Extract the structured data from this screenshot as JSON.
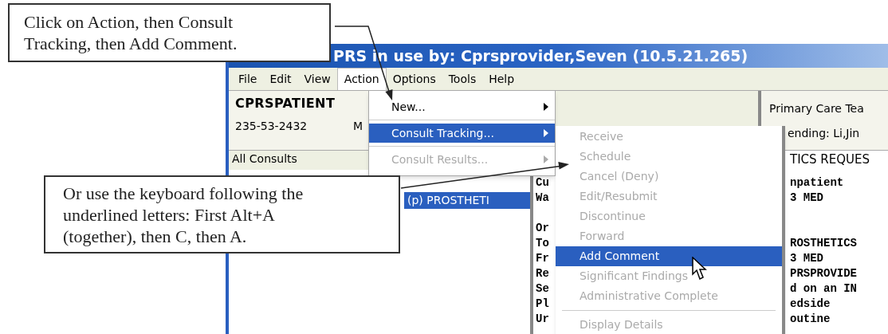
{
  "callouts": [
    {
      "text": "Click on Action, then Consult Tracking, then Add Comment."
    },
    {
      "text": "Or use the keyboard following the underlined letters: First Alt+A (together), then C, then A."
    }
  ],
  "window": {
    "title": "PRS in use by: Cprsprovider,Seven  (10.5.21.265)"
  },
  "menubar": [
    {
      "label": "File",
      "selected": false
    },
    {
      "label": "Edit",
      "selected": false
    },
    {
      "label": "View",
      "selected": false
    },
    {
      "label": "Action",
      "selected": true
    },
    {
      "label": "Options",
      "selected": false
    },
    {
      "label": "Tools",
      "selected": false
    },
    {
      "label": "Help",
      "selected": false
    }
  ],
  "patient": {
    "name": "CPRSPATIENT",
    "ssn": "235-53-2432",
    "column_2": "M"
  },
  "team": {
    "line_1": "Primary Care Tea",
    "line_2": "ending: Li,Jin"
  },
  "consults": {
    "header": "All Consults",
    "items": [
      {
        "label": "(p) PROSTHETI",
        "selected": true
      }
    ]
  },
  "report": {
    "heading": "TICS REQUES",
    "lines": [
      {
        "kind": "text",
        "left": "Cu",
        "right": "npatient"
      },
      {
        "kind": "text",
        "left": "Wa",
        "right": "3 MED"
      },
      {
        "kind": "blank"
      },
      {
        "kind": "text",
        "left": "Or"
      },
      {
        "kind": "text",
        "left": "To",
        "right": "ROSTHETICS"
      },
      {
        "kind": "text",
        "left": "Fr",
        "right": "3 MED"
      },
      {
        "kind": "text",
        "left": "Re",
        "right": "PRSPROVIDE"
      },
      {
        "kind": "text",
        "left": "Se",
        "right": "d on an IN"
      },
      {
        "kind": "text",
        "left": "Pl",
        "right": "edside"
      },
      {
        "kind": "text",
        "left": "Ur",
        "right": "outine"
      }
    ]
  },
  "action_menu": [
    {
      "label": "New...",
      "submenu": true,
      "disabled": false,
      "selected": false
    },
    {
      "label": "Consult Tracking...",
      "submenu": true,
      "disabled": false,
      "selected": true
    },
    {
      "label": "Consult Results...",
      "submenu": true,
      "disabled": true,
      "selected": false
    }
  ],
  "tracking_menu": [
    {
      "label": "Receive",
      "disabled": true,
      "selected": false
    },
    {
      "label": "Schedule",
      "disabled": true,
      "selected": false
    },
    {
      "label": "Cancel (Deny)",
      "disabled": true,
      "selected": false
    },
    {
      "label": "Edit/Resubmit",
      "disabled": true,
      "selected": false
    },
    {
      "label": "Discontinue",
      "disabled": true,
      "selected": false
    },
    {
      "label": "Forward",
      "disabled": true,
      "selected": false
    },
    {
      "label": "Add Comment",
      "disabled": false,
      "selected": true
    },
    {
      "label": "Significant Findings",
      "disabled": true,
      "selected": false
    },
    {
      "label": "Administrative Complete",
      "disabled": true,
      "selected": false
    },
    {
      "kind": "separator"
    },
    {
      "label": "Display Details",
      "disabled": true,
      "selected": false
    }
  ]
}
